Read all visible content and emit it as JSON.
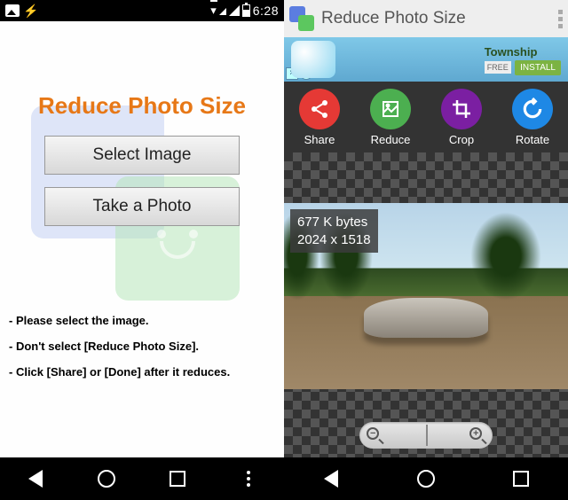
{
  "status": {
    "time": "6:28",
    "data_badge": "R"
  },
  "left": {
    "title": "Reduce Photo Size",
    "select_btn": "Select Image",
    "take_btn": "Take a Photo",
    "instructions": [
      "- Please select the image.",
      "- Don't select [Reduce Photo Size].",
      "- Click [Share] or [Done] after it reduces."
    ]
  },
  "right": {
    "titlebar": "Reduce Photo Size",
    "ad": {
      "name": "Township",
      "free": "FREE",
      "install": "INSTALL",
      "close": "×",
      "info": "i"
    },
    "actions": {
      "share": "Share",
      "reduce": "Reduce",
      "crop": "Crop",
      "rotate": "Rotate"
    },
    "info": {
      "size": "677 K bytes",
      "dim": "2024 x 1518"
    },
    "zoom": {
      "minus": "−",
      "plus": "+"
    }
  }
}
